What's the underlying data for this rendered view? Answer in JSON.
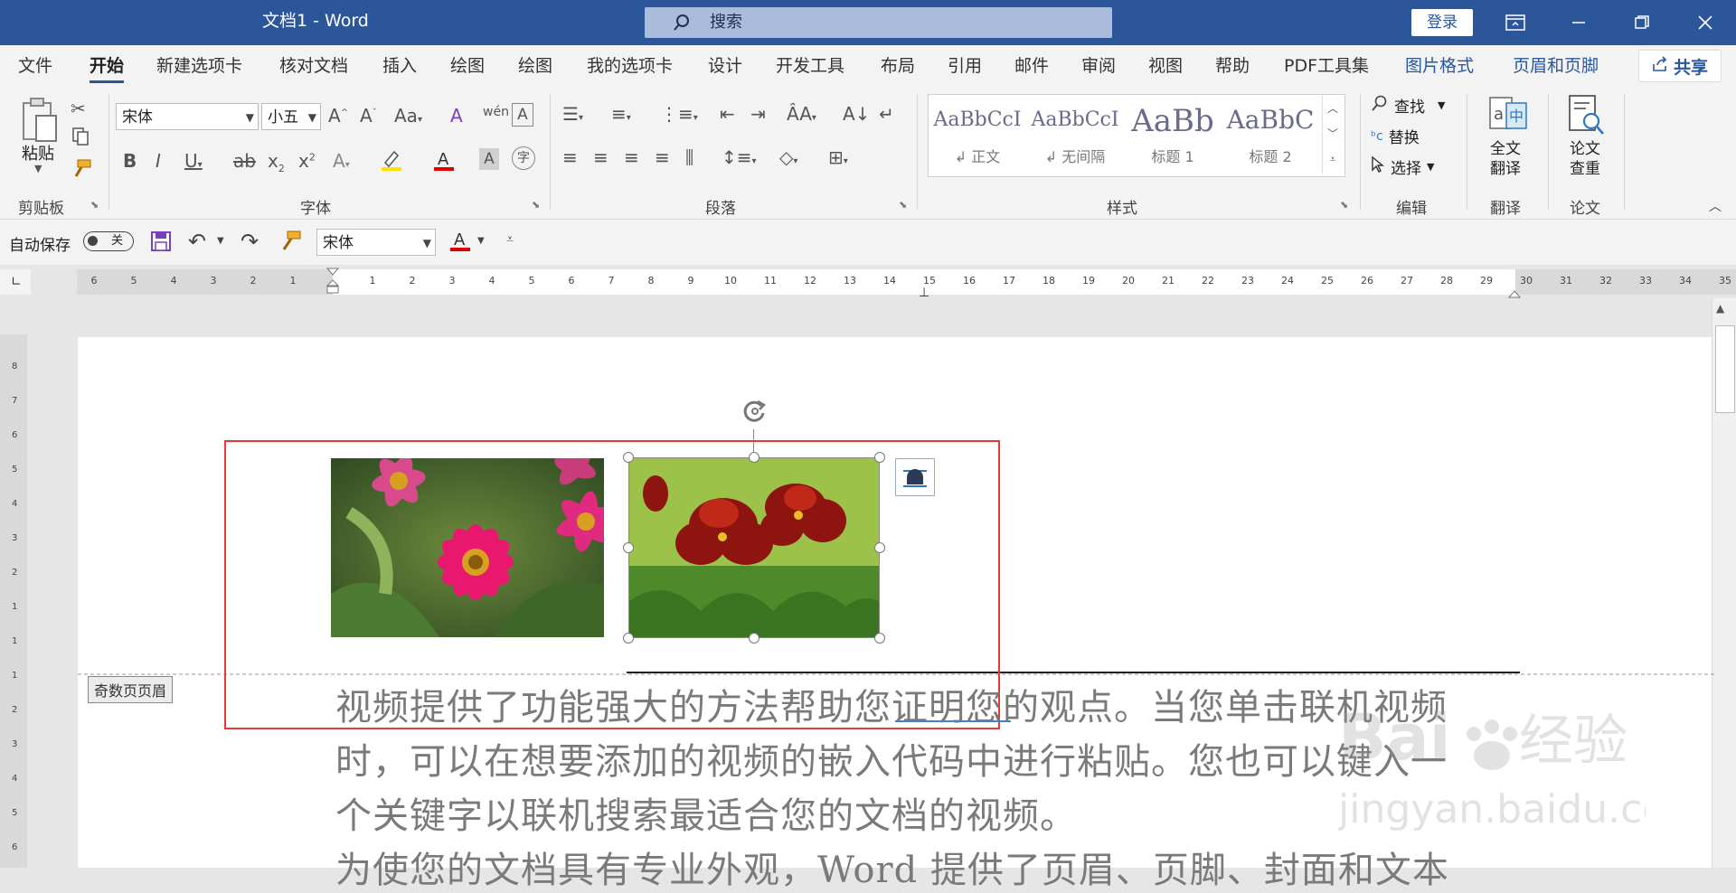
{
  "title_bar": {
    "doc_title": "文档1  -  Word",
    "search_placeholder": "搜索",
    "login_label": "登录"
  },
  "menu_tabs": [
    {
      "label": "文件"
    },
    {
      "label": "开始",
      "active": true
    },
    {
      "label": "新建选项卡"
    },
    {
      "label": "核对文档"
    },
    {
      "label": "插入"
    },
    {
      "label": "绘图"
    },
    {
      "label": "绘图"
    },
    {
      "label": "我的选项卡"
    },
    {
      "label": "设计"
    },
    {
      "label": "开发工具"
    },
    {
      "label": "布局"
    },
    {
      "label": "引用"
    },
    {
      "label": "邮件"
    },
    {
      "label": "审阅"
    },
    {
      "label": "视图"
    },
    {
      "label": "帮助"
    },
    {
      "label": "PDF工具集"
    },
    {
      "label": "图片格式",
      "contextual": true
    },
    {
      "label": "页眉和页脚",
      "contextual": true
    }
  ],
  "share_label": "共享",
  "ribbon": {
    "clipboard": {
      "paste_label": "粘贴",
      "group_label": "剪贴板"
    },
    "font": {
      "font_name": "宋体",
      "font_size": "小五",
      "group_label": "字体"
    },
    "paragraph": {
      "group_label": "段落"
    },
    "styles": {
      "group_label": "样式",
      "items": [
        {
          "sample": "AaBbCcI",
          "name": "↲ 正文"
        },
        {
          "sample": "AaBbCcI",
          "name": "↲ 无间隔"
        },
        {
          "sample": "AaBb",
          "name": "标题 1"
        },
        {
          "sample": "AaBbC",
          "name": "标题 2"
        }
      ]
    },
    "editing": {
      "find": "查找",
      "replace": "替换",
      "select": "选择",
      "group_label": "编辑"
    },
    "translate": {
      "label_line1": "全文",
      "label_line2": "翻译",
      "group_label": "翻译"
    },
    "paper": {
      "label_line1": "论文",
      "label_line2": "查重",
      "group_label": "论文"
    }
  },
  "qat": {
    "autosave_label": "自动保存",
    "autosave_state": "关",
    "font_name": "宋体"
  },
  "ruler": {
    "left_ticks": [
      "6",
      "5",
      "4",
      "3",
      "2",
      "1"
    ],
    "right_ticks": [
      "1",
      "2",
      "3",
      "4",
      "5",
      "6",
      "7",
      "8",
      "9",
      "10",
      "11",
      "12",
      "13",
      "14",
      "15",
      "16",
      "17",
      "18",
      "19",
      "20",
      "21",
      "22",
      "23",
      "24",
      "25",
      "26",
      "27",
      "28",
      "29",
      "30",
      "31",
      "32",
      "33",
      "34",
      "35"
    ],
    "v_ticks": [
      "8",
      "7",
      "6",
      "5",
      "4",
      "3",
      "2",
      "1",
      "1",
      "1",
      "2",
      "3",
      "4",
      "5",
      "6"
    ]
  },
  "document": {
    "header_tag": "奇数页页眉",
    "lines": [
      "视频提供了功能强大的方法帮助您证明您的观点。当您单击联机视频",
      "时，可以在想要添加的视频的嵌入代码中进行粘贴。您也可以键入一",
      "个关键字以联机搜索最适合您的文档的视频。",
      "为使您的文档具有专业外观，Word 提供了页眉、页脚、封面和文本"
    ]
  },
  "colors": {
    "title_bar": "#2b579a",
    "highlight_box": "#e53935",
    "ribbon_bg": "#f3f3f3"
  },
  "watermark": {
    "brand": "Baidu经验",
    "url": "jingyan.baidu.com"
  }
}
